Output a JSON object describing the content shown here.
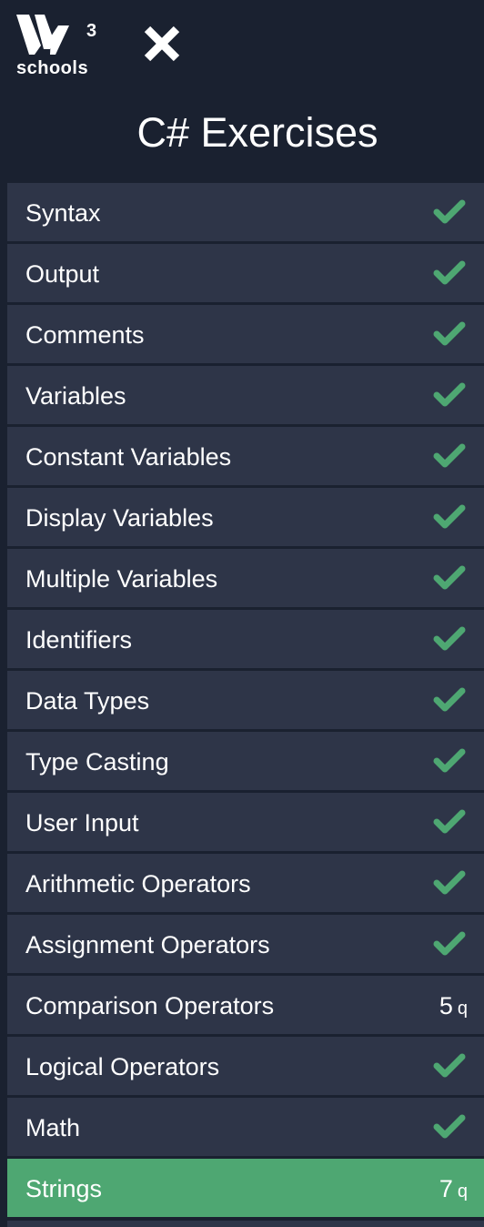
{
  "header": {
    "logo_superscript": "3",
    "logo_text": "schools",
    "close_icon": "close-icon",
    "title": "C# Exercises"
  },
  "colors": {
    "background": "#1a2130",
    "item_background": "#2e3548",
    "active_background": "#4ea772",
    "check_color": "#4ea772"
  },
  "items": [
    {
      "label": "Syntax",
      "status": "done"
    },
    {
      "label": "Output",
      "status": "done"
    },
    {
      "label": "Comments",
      "status": "done"
    },
    {
      "label": "Variables",
      "status": "done"
    },
    {
      "label": "Constant Variables",
      "status": "done"
    },
    {
      "label": "Display Variables",
      "status": "done"
    },
    {
      "label": "Multiple Variables",
      "status": "done"
    },
    {
      "label": "Identifiers",
      "status": "done"
    },
    {
      "label": "Data Types",
      "status": "done"
    },
    {
      "label": "Type Casting",
      "status": "done"
    },
    {
      "label": "User Input",
      "status": "done"
    },
    {
      "label": "Arithmetic Operators",
      "status": "done"
    },
    {
      "label": "Assignment Operators",
      "status": "done"
    },
    {
      "label": "Comparison Operators",
      "status": "count",
      "count": "5",
      "unit": "q"
    },
    {
      "label": "Logical Operators",
      "status": "done"
    },
    {
      "label": "Math",
      "status": "done"
    },
    {
      "label": "Strings",
      "status": "count",
      "count": "7",
      "unit": "q",
      "active": true
    }
  ]
}
